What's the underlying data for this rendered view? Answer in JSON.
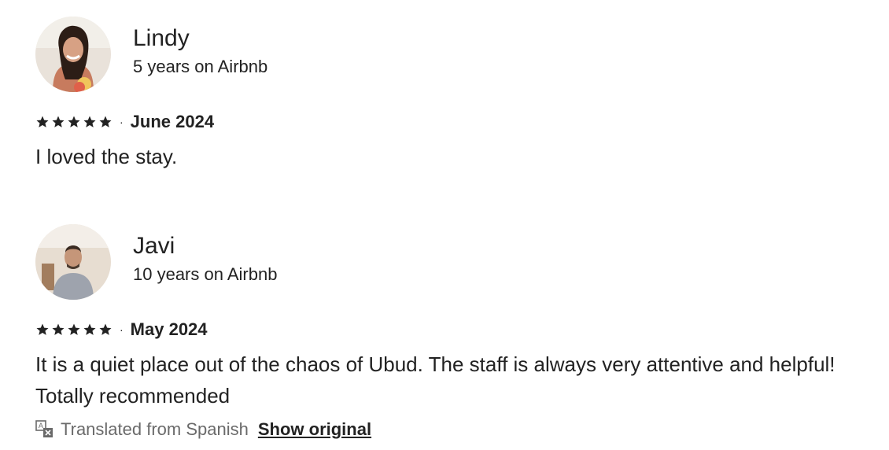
{
  "reviews": [
    {
      "name": "Lindy",
      "tenure": "5 years on Airbnb",
      "rating": 5,
      "separator": "·",
      "date": "June 2024",
      "text": "I loved the stay."
    },
    {
      "name": "Javi",
      "tenure": "10 years on Airbnb",
      "rating": 5,
      "separator": "·",
      "date": "May 2024",
      "text": "It is a quiet place out of the chaos of Ubud. The staff is always very attentive and helpful! Totally recommended",
      "translation": {
        "note": "Translated from Spanish",
        "action": "Show original"
      }
    }
  ],
  "colors": {
    "text": "#222222",
    "muted": "#6a6a6a",
    "star": "#222222"
  }
}
